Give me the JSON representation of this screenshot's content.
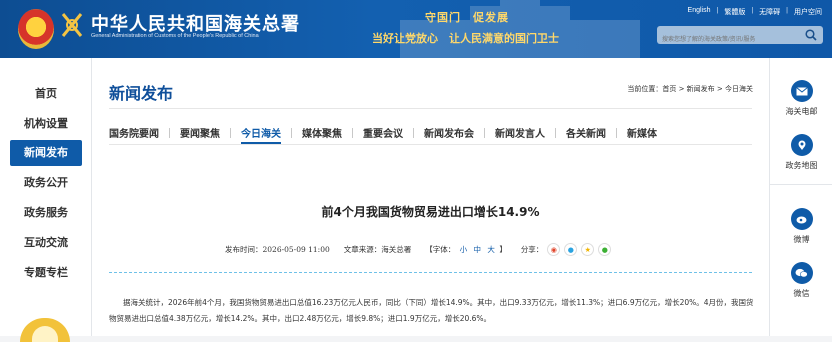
{
  "header": {
    "site_title": "中华人民共和国海关总署",
    "site_subtitle": "General Administration of Customs of the People's Republic of China",
    "slogan_line1": "守国门　促发展",
    "slogan_line2": "当好让党放心　让人民满意的国门卫士",
    "top_links": [
      "English",
      "繁體版",
      "无障碍",
      "用户空间"
    ],
    "search_placeholder": "搜索您想了解的海关政策/资讯/服务"
  },
  "left_nav": {
    "items": [
      "首页",
      "机构设置",
      "新闻发布",
      "政务公开",
      "政务服务",
      "互动交流",
      "专题专栏"
    ],
    "active_index": 2
  },
  "main": {
    "section_title": "新闻发布",
    "breadcrumb": "当前位置：首页 > 新闻发布 > 今日海关",
    "tabs": [
      "国务院要闻",
      "要闻聚焦",
      "今日海关",
      "媒体聚焦",
      "重要会议",
      "新闻发布会",
      "新闻发言人",
      "各关新闻",
      "新媒体"
    ],
    "active_tab": "今日海关",
    "article": {
      "title": "前4个月我国货物贸易进出口增长14.9%",
      "publish_time": "发布时间：2026-05-09 11:00",
      "source": "文章来源：海关总署",
      "font_label_prefix": "【字体：",
      "font_small": "小",
      "font_medium": "中",
      "font_large": "大",
      "font_label_suffix": "】",
      "share_label": "分享：",
      "paragraph": "据海关统计，2026年前4个月，我国货物贸易进出口总值16.23万亿元人民币，同比（下同）增长14.9%。其中，出口9.33万亿元，增长11.3%；进口6.9万亿元，增长20%。4月份，我国货物贸易进出口总值4.38万亿元，增长14.2%。其中，出口2.48万亿元，增长9.8%；进口1.9万亿元，增长20.6%。"
    }
  },
  "right_bar": {
    "items": [
      "海关电邮",
      "政务地图",
      "微博",
      "微信"
    ]
  },
  "colors": {
    "brand_blue": "#0f5ba8",
    "header_gold": "#ffd86a"
  }
}
